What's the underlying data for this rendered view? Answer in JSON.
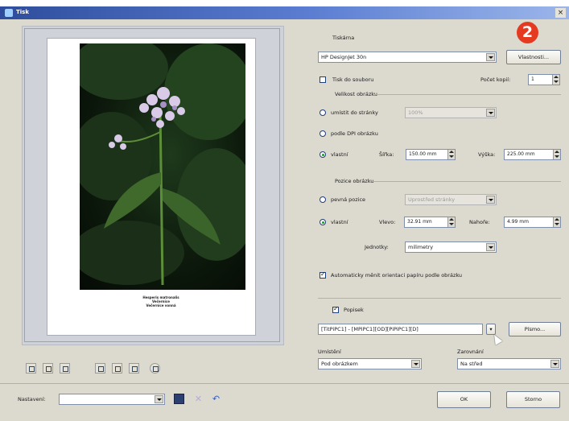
{
  "window": {
    "title": "Tisk"
  },
  "annotation": {
    "badge": "2"
  },
  "preview": {
    "caption_lines": [
      "Hesperis matronalis",
      "Večernice",
      "Večernice vonná"
    ]
  },
  "printer": {
    "section_label": "Tiskárna",
    "selected": "HP DesignJet 30n",
    "properties_button": "Vlastnosti...",
    "print_to_file_label": "Tisk do souboru",
    "print_to_file_checked": false,
    "copies_label": "Počet kopií:",
    "copies_value": "1"
  },
  "image_size": {
    "section_label": "Velikost obrázku",
    "fit_page_label": "umístit do stránky",
    "fit_page_value": "100%",
    "dpi_label": "podle DPI obrázku",
    "custom_label": "vlastní",
    "width_label": "Šířka:",
    "width_value": "150.00 mm",
    "height_label": "Výška:",
    "height_value": "225.00 mm",
    "selected_option": "vlastní"
  },
  "image_position": {
    "section_label": "Pozice obrázku",
    "fixed_label": "pevná pozice",
    "fixed_value": "Uprostřed stránky",
    "custom_label": "vlastní",
    "left_label": "Vlevo:",
    "left_value": "32.91 mm",
    "top_label": "Nahoře:",
    "top_value": "4.99 mm",
    "units_label": "Jednotky:",
    "units_value": "milimetry",
    "selected_option": "vlastní"
  },
  "auto_orientation": {
    "label": "Automaticky měnit orientaci papíru podle obrázku",
    "checked": true
  },
  "caption": {
    "label": "Popisek",
    "checked": true,
    "template": "[TitPiPC1] - [MPiPC1][OD][PiPiPC1][D]",
    "font_button": "Písmo...",
    "placement_label": "Umístění",
    "placement_value": "Pod obrázkem",
    "alignment_label": "Zarovnání",
    "alignment_value": "Na střed"
  },
  "footer": {
    "presets_label": "Nastavení:",
    "presets_value": "",
    "ok_button": "OK",
    "cancel_button": "Storno"
  },
  "toolbar_icons": [
    "align-left-icon",
    "align-center-icon",
    "align-right-icon",
    "align-top-icon",
    "align-middle-icon",
    "align-bottom-icon",
    "zoom-icon"
  ],
  "colors": {
    "titlebar": "#2e4d9c",
    "badge": "#e53a1f",
    "dialog": "#dcd9cf"
  }
}
